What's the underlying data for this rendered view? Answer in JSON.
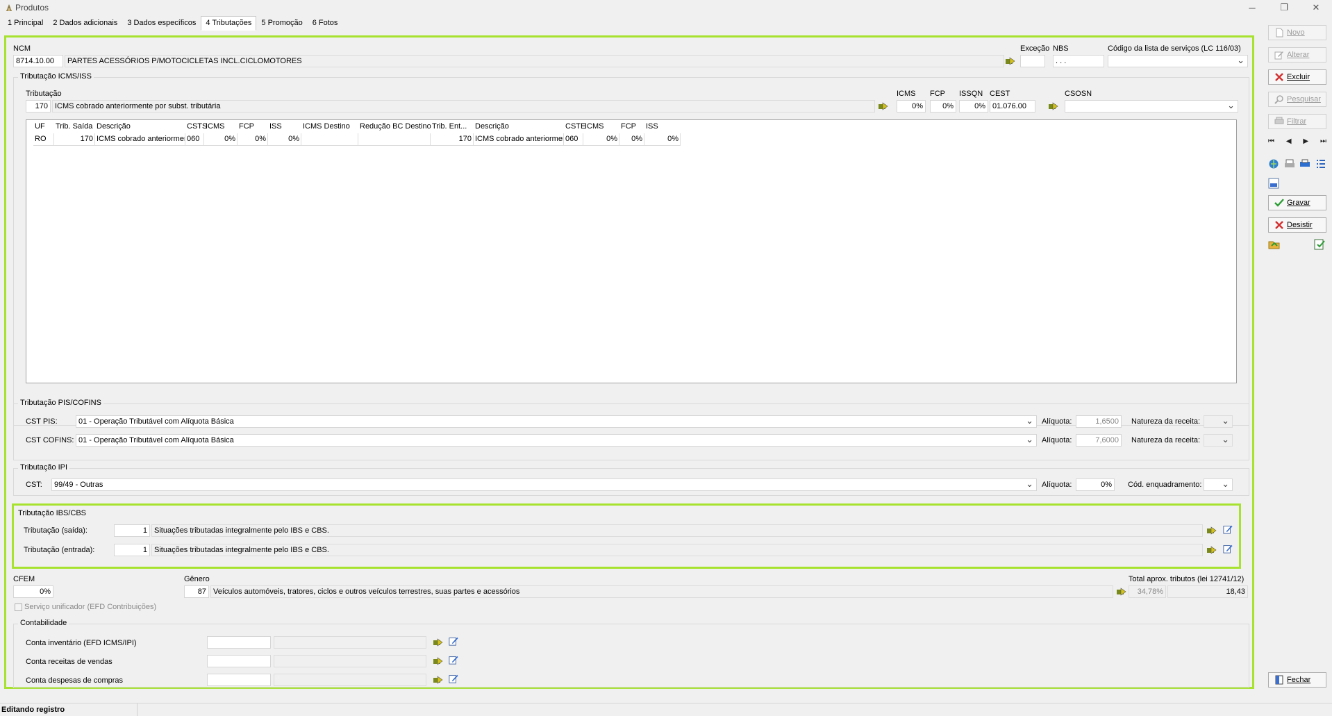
{
  "window": {
    "title": "Produtos"
  },
  "tabs": [
    "1 Principal",
    "2 Dados adicionais",
    "3 Dados específicos",
    "4 Tributações",
    "5 Promoção",
    "6 Fotos"
  ],
  "ncm": {
    "label": "NCM",
    "code": "8714.10.00",
    "description": "PARTES ACESSÓRIOS P/MOTOCICLETAS INCL.CICLOMOTORES",
    "excecao_label": "Exceção",
    "excecao_value": "",
    "nbs_label": "NBS",
    "nbs_value": ". . .",
    "servicos_label": "Código da lista de serviços (LC 116/03)",
    "servicos_value": ""
  },
  "icms": {
    "group_title": "Tributação ICMS/ISS",
    "trib_label": "Tributação",
    "trib_code": "170",
    "trib_desc": "ICMS cobrado anteriormente por subst. tributária",
    "icms_label": "ICMS",
    "icms_value": "0%",
    "fcp_label": "FCP",
    "fcp_value": "0%",
    "issqn_label": "ISSQN",
    "issqn_value": "0%",
    "cest_label": "CEST",
    "cest_value": "01.076.00",
    "csosn_label": "CSOSN",
    "csosn_value": ""
  },
  "grid": {
    "headers": [
      "UF",
      "Trib. Saída",
      "Descrição",
      "CSTS",
      "ICMS",
      "FCP",
      "ISS",
      "ICMS Destino",
      "Redução BC Destino",
      "Trib. Ent...",
      "Descrição",
      "CSTE",
      "ICMS",
      "FCP",
      "ISS"
    ],
    "row": [
      "RO",
      "170",
      "ICMS cobrado anteriormer",
      "060",
      "0%",
      "0%",
      "0%",
      "",
      "",
      "170",
      "ICMS cobrado anteriormer",
      "060",
      "0%",
      "0%",
      "0%"
    ]
  },
  "pis": {
    "group_title": "Tributação PIS/COFINS",
    "cst_pis_label": "CST PIS:",
    "cst_pis_value": "01 - Operação Tributável com Alíquota Básica",
    "aliq_label": "Alíquota:",
    "aliq_pis": "1,6500",
    "natureza_label": "Natureza da receita:",
    "cst_cofins_label": "CST COFINS:",
    "cst_cofins_value": "01 - Operação Tributável com Alíquota Básica",
    "aliq_cofins": "7,6000"
  },
  "ipi": {
    "group_title": "Tributação IPI",
    "cst_label": "CST:",
    "cst_value": "99/49 - Outras",
    "aliq_label": "Alíquota:",
    "aliq_value": "0%",
    "enq_label": "Cód. enquadramento:",
    "enq_value": ""
  },
  "ibs": {
    "group_title": "Tributação IBS/CBS",
    "saida_label": "Tributação (saída):",
    "saida_code": "1",
    "saida_desc": "Situações tributadas integralmente pelo IBS e CBS.",
    "entrada_label": "Tributação (entrada):",
    "entrada_code": "1",
    "entrada_desc": "Situações tributadas integralmente pelo IBS e CBS."
  },
  "misc": {
    "cfem_label": "CFEM",
    "cfem_value": "0%",
    "genero_label": "Gênero",
    "genero_code": "87",
    "genero_desc": "Veículos automóveis, tratores, ciclos e outros veículos terrestres, suas partes e acessórios",
    "total_label": "Total aprox. tributos (lei 12741/12)",
    "total_pct": "34,78%",
    "total_value": "18,43",
    "servico_unificador_label": "Serviço unificador (EFD Contribuições)"
  },
  "contabilidade": {
    "group_title": "Contabilidade",
    "inventario_label": "Conta inventário (EFD ICMS/IPI)",
    "receitas_label": "Conta receitas de vendas",
    "despesas_label": "Conta despesas de compras"
  },
  "toolbar": {
    "novo": "Novo",
    "alterar": "Alterar",
    "excluir": "Excluir",
    "pesquisar": "Pesquisar",
    "filtrar": "Filtrar",
    "gravar": "Gravar",
    "desistir": "Desistir",
    "fechar": "Fechar"
  },
  "status": {
    "text": "Editando registro"
  },
  "colors": {
    "highlight": "#a6e22e",
    "delete_red": "#d32f2f",
    "save_green": "#2e9d36"
  }
}
